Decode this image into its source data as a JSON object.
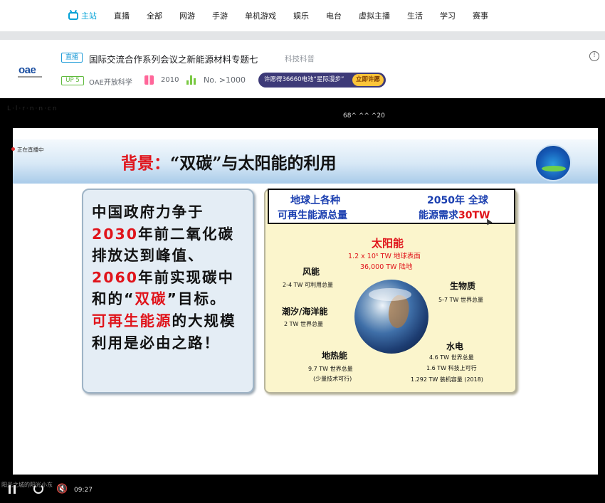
{
  "nav": {
    "items": [
      "主站",
      "直播",
      "全部",
      "网游",
      "手游",
      "单机游戏",
      "娱乐",
      "电台",
      "虚拟主播",
      "生活",
      "学习",
      "赛事"
    ]
  },
  "room": {
    "logo": "oae",
    "live_tag": "直播",
    "title": "国际交流合作系列会议之新能源材料专题七",
    "category": "科技科普",
    "info_icon": "!",
    "up_badge": "UP 5",
    "up_name": "OAE开放科学",
    "gift_count": "2010",
    "rank": "No. >1000",
    "promo_text": "许愿得36660电池“星际漫步”",
    "promo_button": "立即许愿"
  },
  "player": {
    "faint_text": "L·l·r·n·n·cn",
    "title": "68^ ^^ ^20",
    "live_status": "正在直播中",
    "current_time": "09:27",
    "danmaku_line": "阳光之城的阳光小东",
    "mute_icon": "🔇"
  },
  "slide": {
    "title_prefix": "背景：",
    "title_main": "“双碳”与太阳能的利用",
    "left_lines": [
      {
        "parts": [
          {
            "t": "中国政府力争于",
            "red": false
          }
        ]
      },
      {
        "parts": [
          {
            "t": "2030",
            "red": true
          },
          {
            "t": "年前二氧化碳",
            "red": false
          }
        ]
      },
      {
        "parts": [
          {
            "t": "排放达到峰值、",
            "red": false
          }
        ]
      },
      {
        "parts": [
          {
            "t": "2060",
            "red": true
          },
          {
            "t": "年前实现碳中",
            "red": false
          }
        ]
      },
      {
        "parts": [
          {
            "t": "和的“",
            "red": false
          },
          {
            "t": "双碳",
            "red": true
          },
          {
            "t": "”目标。",
            "red": false
          }
        ]
      },
      {
        "parts": [
          {
            "t": "可再生能源",
            "red": true
          },
          {
            "t": "的大规模",
            "red": false
          }
        ]
      },
      {
        "parts": [
          {
            "t": "利用是必由之路！",
            "red": false
          }
        ]
      }
    ],
    "box_left_line1": "地球上各种",
    "box_left_line2": "可再生能源总量",
    "box_right_line1": "2050年 全球",
    "box_right_line2_a": "能源需求",
    "box_right_line2_b": "30TW",
    "sun_title": "太阳能",
    "sun_line1": "1.2 x 10⁵ TW 地球表面",
    "sun_line2": "36,000 TW 陆地",
    "wind_title": "风能",
    "wind_line1": "2-4 TW 可利用总量",
    "tide_title": "潮汐/海洋能",
    "tide_line1": "2 TW 世界总量",
    "geo_title": "地热能",
    "geo_line1": "9.7 TW 世界总量",
    "geo_line2": "(少量技术可行)",
    "bio_title": "生物质",
    "bio_line1": "5-7 TW 世界总量",
    "hydro_title": "水电",
    "hydro_line1": "4.6 TW 世界总量",
    "hydro_line2": "1.6 TW 科技上可行",
    "hydro_line3": "1.292 TW 装机容量 (2018)"
  }
}
